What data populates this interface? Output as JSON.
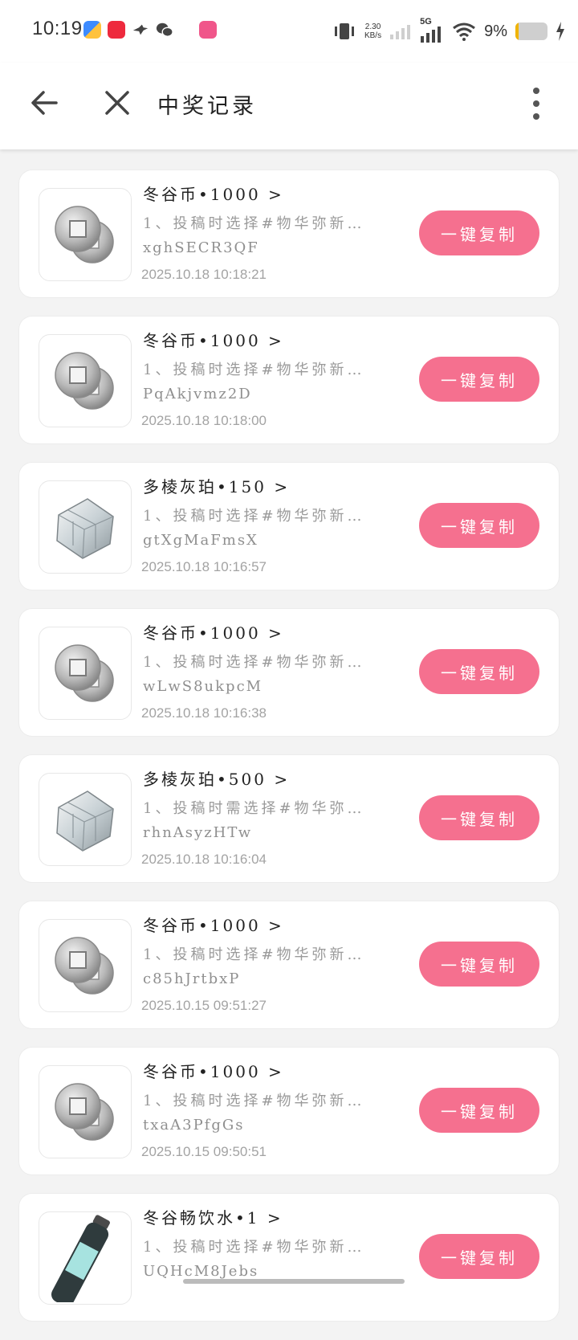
{
  "status_bar": {
    "time": "10:19",
    "net_speed_value": "2.30",
    "net_speed_unit": "KB/s",
    "network": "5G",
    "battery_percent": "9%",
    "battery_level": 0.09,
    "icons": [
      "app-blue-icon",
      "app-red-icon",
      "bird-app-icon",
      "wechat-icon",
      "app-pink-icon",
      "vibrate-icon",
      "signal-weak-icon",
      "signal-5g-icon",
      "wifi-icon",
      "battery-icon",
      "charging-icon"
    ]
  },
  "header": {
    "title": "中奖记录",
    "back_icon": "arrow-left-icon",
    "close_icon": "close-icon",
    "more_icon": "more-vertical-icon"
  },
  "accent_color": "#f5708f",
  "records": [
    {
      "title": "冬谷币•1000 >",
      "desc": "1、投稿时选择#物华弥新…",
      "code": "xghSECR3QF",
      "time": "2025.10.18 10:18:21",
      "button": "一键复制",
      "icon": "coin-icon"
    },
    {
      "title": "冬谷币•1000 >",
      "desc": "1、投稿时选择#物华弥新…",
      "code": "PqAkjvmz2D",
      "time": "2025.10.18 10:18:00",
      "button": "一键复制",
      "icon": "coin-icon"
    },
    {
      "title": "多棱灰珀•150 >",
      "desc": "1、投稿时选择#物华弥新…",
      "code": "gtXgMaFmsX",
      "time": "2025.10.18 10:16:57",
      "button": "一键复制",
      "icon": "crystal-cube-icon"
    },
    {
      "title": "冬谷币•1000 >",
      "desc": "1、投稿时选择#物华弥新…",
      "code": "wLwS8ukpcM",
      "time": "2025.10.18 10:16:38",
      "button": "一键复制",
      "icon": "coin-icon"
    },
    {
      "title": "多棱灰珀•500 >",
      "desc": "1、投稿时需选择#物华弥…",
      "code": "rhnAsyzHTw",
      "time": "2025.10.18 10:16:04",
      "button": "一键复制",
      "icon": "crystal-cube-icon"
    },
    {
      "title": "冬谷币•1000 >",
      "desc": "1、投稿时选择#物华弥新…",
      "code": "c85hJrtbxP",
      "time": "2025.10.15 09:51:27",
      "button": "一键复制",
      "icon": "coin-icon"
    },
    {
      "title": "冬谷币•1000 >",
      "desc": "1、投稿时选择#物华弥新…",
      "code": "txaA3PfgGs",
      "time": "2025.10.15 09:50:51",
      "button": "一键复制",
      "icon": "coin-icon"
    },
    {
      "title": "冬谷畅饮水•1 >",
      "desc": "1、投稿时选择#物华弥新…",
      "code": "UQHcM8Jebs",
      "time": "",
      "button": "一键复制",
      "icon": "water-bottle-icon"
    }
  ]
}
